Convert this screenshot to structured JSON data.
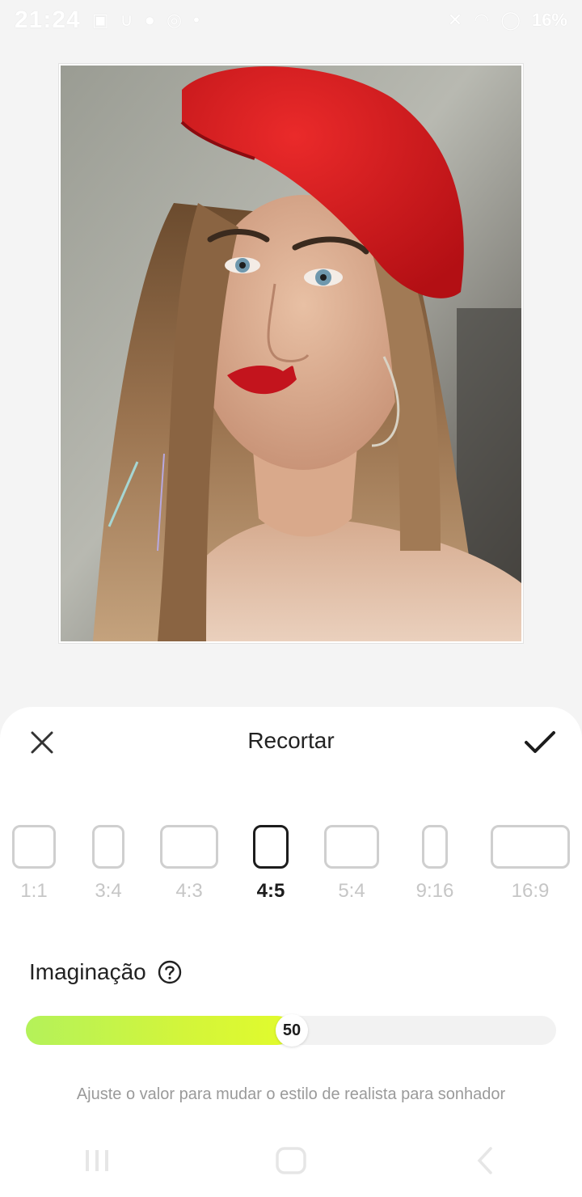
{
  "status_bar": {
    "time": "21:24",
    "battery": "16%"
  },
  "sheet": {
    "title": "Recortar",
    "close_icon": "close-icon",
    "confirm_icon": "checkmark-icon"
  },
  "ratios": {
    "selected": "4:5",
    "items": [
      {
        "label": "1:1"
      },
      {
        "label": "3:4"
      },
      {
        "label": "4:3"
      },
      {
        "label": "4:5"
      },
      {
        "label": "5:4"
      },
      {
        "label": "9:16"
      },
      {
        "label": "16:9"
      }
    ]
  },
  "imagination": {
    "label": "Imaginação",
    "help_icon": "help-icon",
    "value": 50,
    "value_label": "50",
    "min": 0,
    "max": 100,
    "hint": "Ajuste o valor para mudar o estilo de realista para sonhador"
  },
  "colors": {
    "slider_start": "#b4f25a",
    "slider_end": "#e2fb2c",
    "active": "#1c1c1c",
    "inactive": "#cfcfcf"
  }
}
